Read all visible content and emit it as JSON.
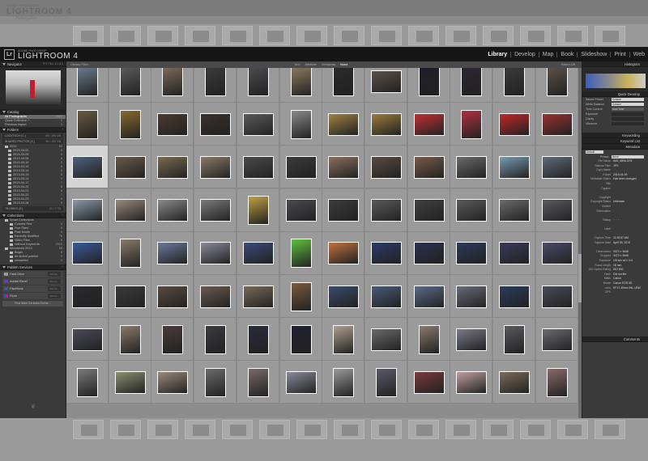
{
  "ghost": {
    "brand_sup": "ADOBE PHOTOSHOP",
    "brand_name": "LIGHTROOM 4",
    "nav_label": "Navigator",
    "library_filter": "Library Filter",
    "filter_opts": [
      "Text",
      "Attribute",
      "Metadata",
      "None"
    ]
  },
  "app": {
    "logo": "Lr",
    "brand_sup": "ADOBE PHOTOSHOP",
    "brand_name": "LIGHTROOM 4",
    "modules": [
      "Library",
      "Develop",
      "Map",
      "Book",
      "Slideshow",
      "Print",
      "Web"
    ]
  },
  "left": {
    "navigator": {
      "title": "Navigator",
      "zoom": "FIT  FILL  1:1  3:1"
    },
    "catalog": {
      "title": "Catalog",
      "items": [
        {
          "label": "All Photographs",
          "count": "2910"
        },
        {
          "label": "Quick Collection +",
          "count": "0"
        },
        {
          "label": "Previous Import",
          "count": "0"
        }
      ]
    },
    "folders": {
      "title": "Folders",
      "volumes": [
        {
          "label": "LOCKTECH (C:)",
          "count": "69 / 100 GB"
        },
        {
          "label": "SHARED PHOTOS (X:)",
          "count": "90 / 150 GB"
        }
      ],
      "items": [
        {
          "label": "2013",
          "count": "90"
        },
        {
          "label": "2013-03-02",
          "count": "5"
        },
        {
          "label": "2013-03-03",
          "count": "4"
        },
        {
          "label": "2013-03-09",
          "count": "8"
        },
        {
          "label": "2013-03-10",
          "count": "3"
        },
        {
          "label": "2013-03-13",
          "count": "9"
        },
        {
          "label": "2013-03-14",
          "count": "6"
        },
        {
          "label": "2013-04-13",
          "count": "5"
        },
        {
          "label": "2013-04-14",
          "count": "4"
        },
        {
          "label": "2013-04-17",
          "count": "7"
        },
        {
          "label": "2013-04-20",
          "count": "8"
        },
        {
          "label": "2013-04-21",
          "count": "6"
        },
        {
          "label": "2013-04-22",
          "count": "7"
        },
        {
          "label": "2013-04-23",
          "count": "9"
        },
        {
          "label": "2013-04-28",
          "count": "9"
        }
      ],
      "volume3": {
        "label": "TB DISKS (Z:)",
        "count": "20 / 2 TB"
      }
    },
    "collections": {
      "title": "Collections",
      "items": [
        {
          "label": "Smart Collections",
          "count": ""
        },
        {
          "label": "Colored Red",
          "count": "0"
        },
        {
          "label": "Five Stars",
          "count": "0"
        },
        {
          "label": "Past Month",
          "count": "0"
        },
        {
          "label": "Recently Modified",
          "count": "78"
        },
        {
          "label": "Video Files",
          "count": "0"
        },
        {
          "label": "Without Keywords",
          "count": "2910"
        },
        {
          "label": "Wonderzin 2013",
          "count": "58"
        },
        {
          "label": "Boger",
          "count": "6"
        },
        {
          "label": "for terlest publish",
          "count": "9"
        },
        {
          "label": "unwanted",
          "count": "9"
        }
      ]
    },
    "publish": {
      "title": "Publish Services",
      "items": [
        {
          "label": "Hard Drive",
          "set": "Set Up..."
        },
        {
          "label": "Adobe Revel",
          "set": "Set Up..."
        },
        {
          "label": "Facebook",
          "set": "Set Up..."
        },
        {
          "label": "Flickr",
          "set": "Set Up..."
        }
      ],
      "find_more": "Find More Services Online..."
    }
  },
  "center": {
    "filter_title": "Library Filter :",
    "filter_opts": [
      "Text",
      "Attribute",
      "Metadata",
      "None"
    ],
    "filter_off": "Filters Off",
    "selected_number": "2694"
  },
  "right": {
    "histogram": "Histogram",
    "quick_develop": "Quick Develop",
    "qd_rows": [
      {
        "label": "Saved Preset",
        "value": "Custom"
      },
      {
        "label": "White Balance",
        "value": "Custom"
      },
      {
        "label": "Tone Control",
        "value": "Auto Tone"
      },
      {
        "label": "Exposure",
        "value": ""
      },
      {
        "label": "Clarity",
        "value": ""
      },
      {
        "label": "Vibrance",
        "value": ""
      }
    ],
    "keywording": "Keywording",
    "keyword_list": "Keyword List",
    "metadata": "Metadata",
    "metadata_preset": "Default",
    "preset_label": "Preset",
    "preset_value": "None",
    "meta_rows": [
      {
        "k": "File Name",
        "v": "IMG_5896.CR2"
      },
      {
        "k": "Sidecar Files",
        "v": "JPG"
      },
      {
        "k": "Copy Name",
        "v": ""
      },
      {
        "k": "Folder",
        "v": "2013-04-09"
      },
      {
        "k": "Metadata Status",
        "v": "Has been changed"
      },
      {
        "k": "Title",
        "v": ""
      },
      {
        "k": "Caption",
        "v": ""
      },
      {
        "k": "",
        "v": ""
      },
      {
        "k": "Copyright",
        "v": ""
      },
      {
        "k": "Copyright Status",
        "v": "Unknown"
      },
      {
        "k": "Creator",
        "v": ""
      },
      {
        "k": "Sublocation",
        "v": ""
      },
      {
        "k": "",
        "v": ""
      },
      {
        "k": "Rating",
        "v": "· · · · ·"
      },
      {
        "k": "",
        "v": ""
      },
      {
        "k": "Label",
        "v": ""
      },
      {
        "k": "",
        "v": ""
      },
      {
        "k": "Capture Time",
        "v": "11:30:57 AM"
      },
      {
        "k": "Capture Date",
        "v": "April 09, 2013"
      },
      {
        "k": "",
        "v": ""
      },
      {
        "k": "Dimensions",
        "v": "3472 x 3648"
      },
      {
        "k": "Cropped",
        "v": "3472 x 3648"
      },
      {
        "k": "Exposure",
        "v": "1/6 sec at f / 4.0"
      },
      {
        "k": "Focal Length",
        "v": "18 mm"
      },
      {
        "k": "ISO Speed Rating",
        "v": "ISO 500"
      },
      {
        "k": "Flash",
        "v": "Did not fire"
      },
      {
        "k": "Make",
        "v": "Canon"
      },
      {
        "k": "Model",
        "v": "Canon EOS 6D"
      },
      {
        "k": "Lens",
        "v": "EF17-40mm f/4L USM"
      },
      {
        "k": "GPS",
        "v": ""
      }
    ],
    "comments": "Comments"
  },
  "grid": {
    "selected_cell": 24,
    "thumbs": [
      {
        "o": "p",
        "c": "#6b7a8a"
      },
      {
        "o": "p",
        "c": "#5a5a5a"
      },
      {
        "o": "p",
        "c": "#7a6a5a"
      },
      {
        "o": "p",
        "c": "#3a3a3a"
      },
      {
        "o": "p",
        "c": "#4a4a50"
      },
      {
        "o": "p",
        "c": "#8a7a60"
      },
      {
        "o": "p",
        "c": "#2a2a2a"
      },
      {
        "o": "l",
        "c": "#5b5048"
      },
      {
        "o": "p",
        "c": "#1e1e28"
      },
      {
        "o": "p",
        "c": "#2a2630"
      },
      {
        "o": "p",
        "c": "#3a3a3a"
      },
      {
        "o": "p",
        "c": "#5a5048"
      },
      {
        "o": "p",
        "c": "#6a5a40"
      },
      {
        "o": "p",
        "c": "#8a6a30"
      },
      {
        "o": "l",
        "c": "#4a3a30"
      },
      {
        "o": "l",
        "c": "#3a302a"
      },
      {
        "o": "l",
        "c": "#5a5a5a"
      },
      {
        "o": "p",
        "c": "#8a8a8a"
      },
      {
        "o": "l",
        "c": "#a08040"
      },
      {
        "o": "l",
        "c": "#9a7a3a"
      },
      {
        "o": "l",
        "c": "#c03030"
      },
      {
        "o": "p",
        "c": "#b03040"
      },
      {
        "o": "l",
        "c": "#c02828"
      },
      {
        "o": "l",
        "c": "#9a3030"
      },
      {
        "o": "l",
        "c": "#50607a"
      },
      {
        "o": "l",
        "c": "#6a5a4a"
      },
      {
        "o": "l",
        "c": "#7a6a50"
      },
      {
        "o": "l",
        "c": "#8a7a6a"
      },
      {
        "o": "l",
        "c": "#4a4a4a"
      },
      {
        "o": "l",
        "c": "#3a3a3a"
      },
      {
        "o": "l",
        "c": "#8a7060"
      },
      {
        "o": "l",
        "c": "#5a4a40"
      },
      {
        "o": "l",
        "c": "#7a5a4a"
      },
      {
        "o": "l",
        "c": "#6a6a6a"
      },
      {
        "o": "l",
        "c": "#7a9ab0"
      },
      {
        "o": "l",
        "c": "#606a7a"
      },
      {
        "o": "l",
        "c": "#8a9aaa"
      },
      {
        "o": "l",
        "c": "#9a8a7a"
      },
      {
        "o": "l",
        "c": "#8a8a8a"
      },
      {
        "o": "l",
        "c": "#7a7a7a"
      },
      {
        "o": "p",
        "c": "#c0a040"
      },
      {
        "o": "l",
        "c": "#4a4a50"
      },
      {
        "o": "l",
        "c": "#3a3a3a"
      },
      {
        "o": "l",
        "c": "#5a5a5a"
      },
      {
        "o": "l",
        "c": "#404040"
      },
      {
        "o": "l",
        "c": "#5a5a5a"
      },
      {
        "o": "l",
        "c": "#6a6a6a"
      },
      {
        "o": "l",
        "c": "#5a5a60"
      },
      {
        "o": "l",
        "c": "#3a5a9a"
      },
      {
        "o": "p",
        "c": "#8a7a6a"
      },
      {
        "o": "l",
        "c": "#6a7a9a"
      },
      {
        "o": "l",
        "c": "#8a8a9a"
      },
      {
        "o": "l",
        "c": "#3a4a7a"
      },
      {
        "o": "p",
        "c": "#60c040"
      },
      {
        "o": "l",
        "c": "#c07040"
      },
      {
        "o": "l",
        "c": "#2a3a6a"
      },
      {
        "o": "l",
        "c": "#2a3050"
      },
      {
        "o": "l",
        "c": "#2a3a5a"
      },
      {
        "o": "l",
        "c": "#3a3a5a"
      },
      {
        "o": "l",
        "c": "#4a4a6a"
      },
      {
        "o": "l",
        "c": "#2a2a30"
      },
      {
        "o": "l",
        "c": "#3a3a3a"
      },
      {
        "o": "l",
        "c": "#5a4a40"
      },
      {
        "o": "l",
        "c": "#6a5a50"
      },
      {
        "o": "l",
        "c": "#7a6a5a"
      },
      {
        "o": "p",
        "c": "#7a5a40"
      },
      {
        "o": "l",
        "c": "#3a4a6a"
      },
      {
        "o": "l",
        "c": "#4a5a7a"
      },
      {
        "o": "l",
        "c": "#5a6a8a"
      },
      {
        "o": "l",
        "c": "#6a6a7a"
      },
      {
        "o": "l",
        "c": "#2a3a5a"
      },
      {
        "o": "l",
        "c": "#4a4a5a"
      },
      {
        "o": "l",
        "c": "#4a4a5a"
      },
      {
        "o": "p",
        "c": "#8a7a6a"
      },
      {
        "o": "p",
        "c": "#4a3a3a"
      },
      {
        "o": "p",
        "c": "#3a3a40"
      },
      {
        "o": "p",
        "c": "#2a2a3a"
      },
      {
        "o": "p",
        "c": "#202030"
      },
      {
        "o": "p",
        "c": "#b0a090"
      },
      {
        "o": "l",
        "c": "#6a6a6a"
      },
      {
        "o": "p",
        "c": "#8a7a70"
      },
      {
        "o": "l",
        "c": "#7a7a8a"
      },
      {
        "o": "p",
        "c": "#5a5a60"
      },
      {
        "o": "l",
        "c": "#6a6a70"
      },
      {
        "o": "p",
        "c": "#7a7a7a"
      },
      {
        "o": "l",
        "c": "#8a9070"
      },
      {
        "o": "l",
        "c": "#9a8a7a"
      },
      {
        "o": "p",
        "c": "#6a6a6a"
      },
      {
        "o": "p",
        "c": "#7a6a6a"
      },
      {
        "o": "l",
        "c": "#8a8a9a"
      },
      {
        "o": "p",
        "c": "#9a9a9a"
      },
      {
        "o": "p",
        "c": "#5a5a6a"
      },
      {
        "o": "l",
        "c": "#7a3a3a"
      },
      {
        "o": "l",
        "c": "#c0a0a0"
      },
      {
        "o": "l",
        "c": "#7a6a5a"
      },
      {
        "o": "p",
        "c": "#8a6a6a"
      }
    ]
  }
}
